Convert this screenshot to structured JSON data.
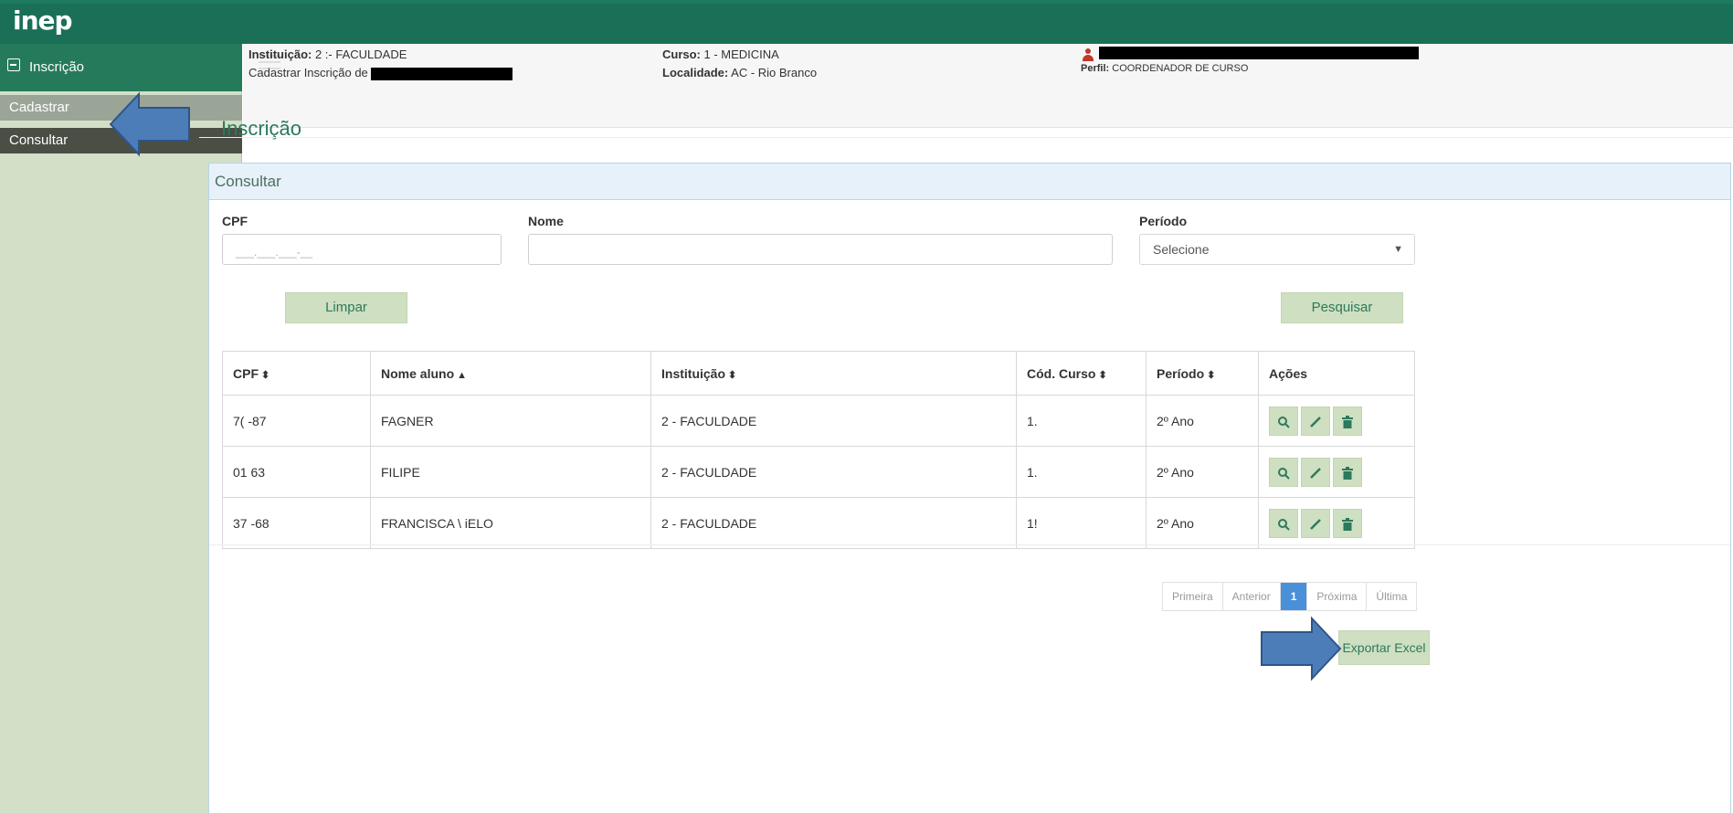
{
  "app": {
    "logo": "inep"
  },
  "sidebar": {
    "header": "Inscrição",
    "items": [
      {
        "label": "Cadastrar"
      },
      {
        "label": "Consultar"
      }
    ]
  },
  "header": {
    "instituicao_label": "Instituição:",
    "instituicao_value": "2    :- FACULDADE",
    "cadastrar_text": "Cadastrar Inscrição de",
    "curso_label": "Curso:",
    "curso_value": "1        - MEDICINA",
    "localidade_label": "Localidade:",
    "localidade_value": "AC - Rio Branco",
    "perfil_label": "Perfil:",
    "perfil_value": "COORDENADOR DE CURSO"
  },
  "page": {
    "title": "Inscrição"
  },
  "panel": {
    "title": "Consultar",
    "cpf_label": "CPF",
    "cpf_placeholder": "___.___.___-__",
    "nome_label": "Nome",
    "nome_value": "",
    "periodo_label": "Período",
    "periodo_value": "Selecione",
    "clear_button": "Limpar",
    "search_button": "Pesquisar"
  },
  "table": {
    "columns": [
      "CPF",
      "Nome aluno",
      "Instituição",
      "Cód. Curso",
      "Período",
      "Ações"
    ],
    "rows": [
      {
        "cpf": "7(            -87",
        "nome": "FAGNER",
        "instituicao": "2     - FACULDADE",
        "cod_curso": "1.",
        "periodo": "2º Ano"
      },
      {
        "cpf": "01            63",
        "nome": "FILIPE",
        "instituicao": "2     - FACULDADE",
        "cod_curso": "1.",
        "periodo": "2º Ano"
      },
      {
        "cpf": "37            -68",
        "nome": "FRANCISCA \\                    iELO",
        "instituicao": "2     - FACULDADE",
        "cod_curso": "1!",
        "periodo": "2º Ano"
      }
    ]
  },
  "pagination": {
    "first": "Primeira",
    "prev": "Anterior",
    "current": "1",
    "next": "Próxima",
    "last": "Última"
  },
  "export_button": "Exportar Excel",
  "colors": {
    "topbar": "#1a7056",
    "sidebar_bg": "#d3dfc6",
    "accent": "#2b7a5c",
    "button_bg": "#cfdfc1",
    "arrow": "#4d7db8",
    "pager_active": "#4a90d9"
  }
}
